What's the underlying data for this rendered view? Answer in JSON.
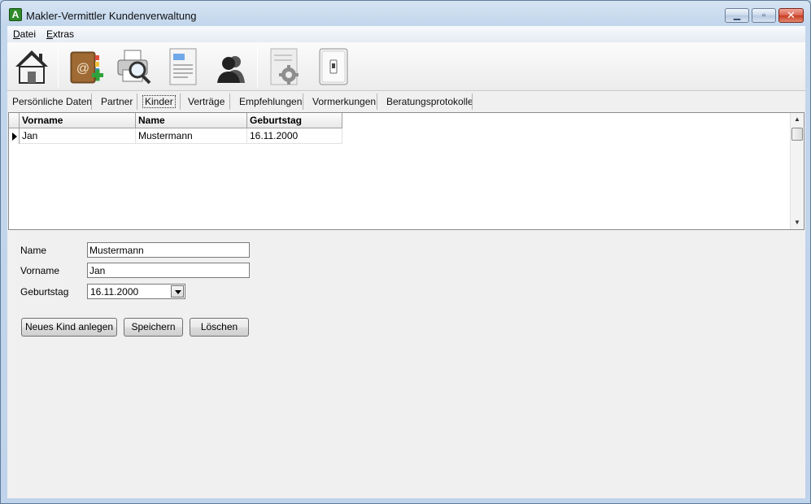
{
  "window": {
    "app_icon_letter": "A",
    "title": "Makler-Vermittler Kundenverwaltung",
    "min_glyph": "▁",
    "max_glyph": "▫",
    "close_glyph": "✕"
  },
  "menu": {
    "items": [
      {
        "accel": "D",
        "rest": "atei"
      },
      {
        "accel": "E",
        "rest": "xtras"
      }
    ]
  },
  "toolbar": {
    "buttons": [
      {
        "icon": "home-icon"
      },
      {
        "icon": "address-book-add-icon"
      },
      {
        "icon": "print-preview-icon"
      },
      {
        "icon": "document-icon"
      },
      {
        "icon": "contacts-icon"
      },
      {
        "icon": "settings-document-icon"
      },
      {
        "icon": "exit-switch-icon"
      }
    ]
  },
  "tabs": [
    {
      "label": "Persönliche Daten"
    },
    {
      "label": "Partner"
    },
    {
      "label": "Kinder",
      "active": true
    },
    {
      "label": "Verträge"
    },
    {
      "label": "Empfehlungen"
    },
    {
      "label": "Vormerkungen"
    },
    {
      "label": "Beratungsprotokolle"
    }
  ],
  "grid": {
    "columns": [
      "Vorname",
      "Name",
      "Geburtstag"
    ],
    "rows": [
      [
        "Jan",
        "Mustermann",
        "16.11.2000"
      ]
    ]
  },
  "form": {
    "name_label": "Name",
    "name_value": "Mustermann",
    "vorname_label": "Vorname",
    "vorname_value": "Jan",
    "geburtstag_label": "Geburtstag",
    "geburtstag_value": "16.11.2000"
  },
  "buttons": {
    "new_label": "Neues Kind anlegen",
    "save_label": "Speichern",
    "delete_label": "Löschen"
  }
}
